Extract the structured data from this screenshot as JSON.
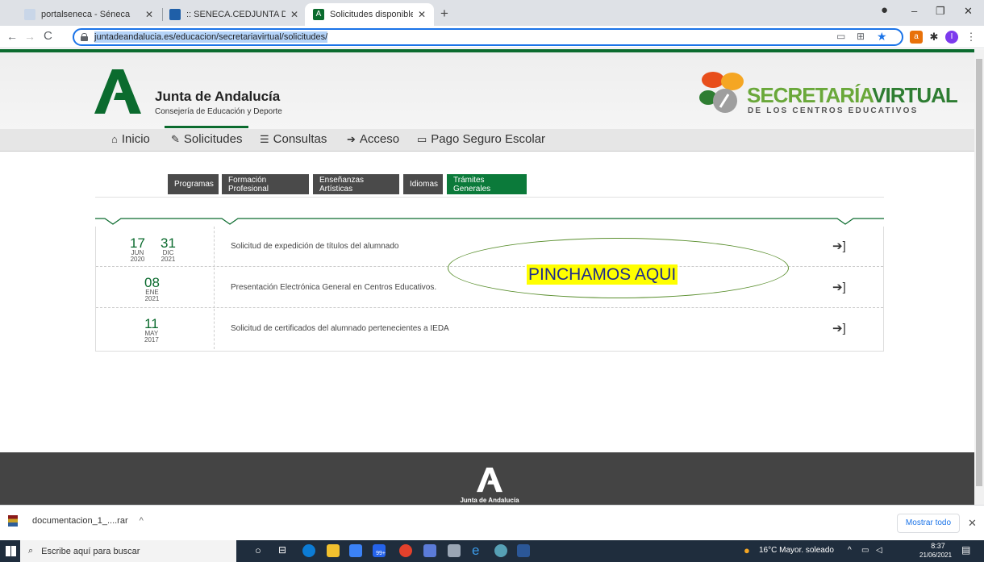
{
  "browser": {
    "tabs": [
      {
        "title": "portalseneca - Séneca"
      },
      {
        "title": ":: SENECA.CEDJUNTA DE ANDALU"
      },
      {
        "title": "Solicitudes disponibles"
      }
    ],
    "url": "juntadeandalucia.es/educacion/secretariavirtual/solicitudes/"
  },
  "header": {
    "org_name": "Junta de Andalucía",
    "org_sub": "Consejería de Educación y Deporte",
    "sv_title_1": "SECRETARÍA",
    "sv_title_2": "VIRTUAL",
    "sv_sub": "DE LOS CENTROS EDUCATIVOS"
  },
  "menu": [
    {
      "label": "Inicio",
      "icon": "home-icon"
    },
    {
      "label": "Solicitudes",
      "icon": "pencil-icon"
    },
    {
      "label": "Consultas",
      "icon": "list-icon"
    },
    {
      "label": "Acceso",
      "icon": "sign-in-icon"
    },
    {
      "label": "Pago Seguro Escolar",
      "icon": "card-icon"
    }
  ],
  "subtabs": [
    {
      "label": "Programas"
    },
    {
      "label": "Formación Profesional"
    },
    {
      "label": "Enseñanzas Artísticas"
    },
    {
      "label": "Idiomas"
    },
    {
      "label": "Trámites Generales"
    }
  ],
  "rows": [
    {
      "start_day": "17",
      "start_month": "JUN",
      "start_year": "2020",
      "end_day": "31",
      "end_month": "DIC",
      "end_year": "2021",
      "text": "Solicitud de expedición de títulos del alumnado"
    },
    {
      "start_day": "08",
      "start_month": "ENE",
      "start_year": "2021",
      "text": "Presentación Electrónica General en Centros Educativos."
    },
    {
      "start_day": "11",
      "start_month": "MAY",
      "start_year": "2017",
      "text": "Solicitud de certificados del alumnado pertenecientes a IEDA"
    }
  ],
  "footer": {
    "logo_text": "Junta de Andalucía"
  },
  "annotation": "PINCHAMOS AQUI",
  "download": {
    "file": "documentacion_1_....rar",
    "show_all": "Mostrar todo"
  },
  "taskbar": {
    "search": "Escribe aquí para buscar",
    "weather": "16°C  Mayor. soleado",
    "time": "8:37",
    "date": "21/06/2021",
    "badge": "99+"
  },
  "colors": {
    "brand_green": "#0b6b2e",
    "sv_green": "#6aa83a"
  }
}
